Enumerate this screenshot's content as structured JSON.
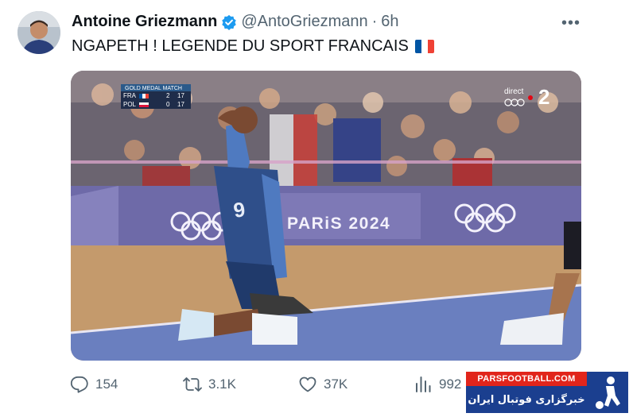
{
  "tweet": {
    "author_name": "Antoine Griezmann",
    "handle": "@AntoGriezmann",
    "separator": "·",
    "time": "6h",
    "text": "NGAPETH ! LEGENDE DU SPORT FRANCAIS",
    "more_label": "•••"
  },
  "media": {
    "scoreboard_title": "GOLD MEDAL MATCH",
    "teams": [
      {
        "code": "FRA",
        "sets": "2",
        "points": "17"
      },
      {
        "code": "POL",
        "sets": "0",
        "points": "17"
      }
    ],
    "broadcaster_label": "direct",
    "channel_number": "2",
    "board_text": "PARiS 2024"
  },
  "actions": {
    "replies": "154",
    "reposts": "3.1K",
    "likes": "37K",
    "views": "992"
  },
  "watermark": {
    "site": "PARSFOOTBALL.COM",
    "tagline": "خبرگزاری فوتبال ایران"
  },
  "colors": {
    "verified_blue": "#1d9bf0",
    "muted_text": "#536471",
    "court_purple": "#6e6aa8",
    "court_floor": "#c49a6c",
    "flag_blue": "#0055a4",
    "flag_red": "#ef4135"
  },
  "icons": [
    "verified-badge-icon",
    "more-icon",
    "france-flag-icon",
    "reply-icon",
    "repost-icon",
    "like-icon",
    "views-icon",
    "olympic-rings-icon"
  ]
}
